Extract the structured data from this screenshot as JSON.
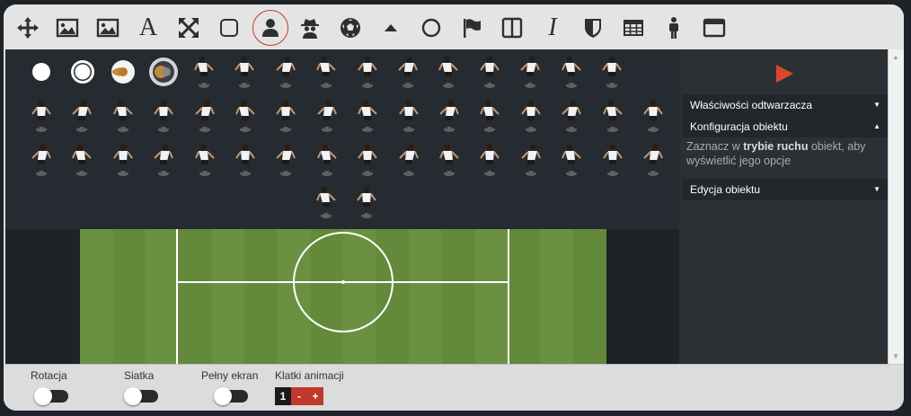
{
  "toolbar": {
    "tools": [
      {
        "icon": "move-icon"
      },
      {
        "icon": "image-icon"
      },
      {
        "icon": "image-alt-icon"
      },
      {
        "icon": "text-icon",
        "glyph": "A"
      },
      {
        "icon": "expand-icon"
      },
      {
        "icon": "rounded-square-icon"
      },
      {
        "icon": "person-icon",
        "active": true
      },
      {
        "icon": "spy-icon"
      },
      {
        "icon": "football-icon"
      },
      {
        "icon": "triangle-icon"
      },
      {
        "icon": "circle-icon"
      },
      {
        "icon": "flag-icon"
      },
      {
        "icon": "columns-icon"
      },
      {
        "icon": "italic-icon",
        "glyph": "I"
      },
      {
        "icon": "shield-icon"
      },
      {
        "icon": "table-icon"
      },
      {
        "icon": "male-figure-icon"
      },
      {
        "icon": "window-icon"
      }
    ]
  },
  "palette": {
    "ball_items": [
      {
        "icon": "white-dot-icon"
      },
      {
        "icon": "ring-dot-icon"
      },
      {
        "icon": "ball-icon"
      },
      {
        "icon": "ball-selected-icon"
      }
    ],
    "player_rows": [
      11,
      16,
      16,
      2
    ]
  },
  "pitch": {
    "grass_light": "#6a9141",
    "grass_dark": "#628a3a",
    "line_color": "#ffffff"
  },
  "side_panel": {
    "play_icon": "play-icon",
    "sections": [
      {
        "label": "Właściwości odtwarzacza",
        "caret": "▼"
      },
      {
        "label": "Konfiguracja obiektu",
        "caret": "▲"
      }
    ],
    "hint_pre": "Zaznacz w ",
    "hint_bold": "trybie ruchu",
    "hint_post": " obiekt, aby wyświetlić jego opcje",
    "edit_section": {
      "label": "Edycja obiektu",
      "caret": "▼"
    }
  },
  "scrollbar": {
    "up": "▲",
    "down": "▼"
  },
  "bottom": {
    "rotation_label": "Rotacja",
    "grid_label": "Siatka",
    "fullscreen_label": "Pełny ekran",
    "frames_label": "Klatki animacji",
    "frame_value": "1",
    "minus_label": "-",
    "plus_label": "+"
  },
  "colors": {
    "accent": "#c0392b",
    "panel": "#262b31",
    "frame_bg": "#1a1a1a",
    "button_red": "#c0392b",
    "play": "#d9472b"
  }
}
